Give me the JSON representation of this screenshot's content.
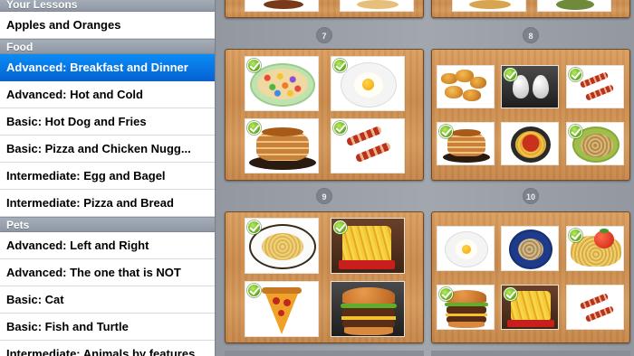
{
  "sidebar": {
    "sections": [
      {
        "title": "Your Lessons",
        "items": [
          "Apples and Oranges"
        ]
      },
      {
        "title": "Food",
        "items": [
          "Advanced: Breakfast and Dinner",
          "Advanced: Hot and Cold",
          "Basic: Hot Dog and Fries",
          "Basic: Pizza and Chicken Nugg...",
          "Intermediate: Egg and Bagel",
          "Intermediate: Pizza and Bread"
        ]
      },
      {
        "title": "Pets",
        "items": [
          "Advanced: Left and Right",
          "Advanced: The one that is NOT",
          "Basic: Cat",
          "Basic: Fish and Turtle",
          "Intermediate: Animals by features"
        ]
      }
    ],
    "selected_item": "Advanced: Breakfast and Dinner"
  },
  "cards": {
    "page_numbers": [
      "7",
      "8",
      "9",
      "10"
    ],
    "card7": {
      "tiles": [
        "cereal-bowl",
        "fried-egg",
        "pancakes",
        "bacon"
      ],
      "checked": [
        true,
        true,
        true,
        true
      ]
    },
    "card8": {
      "tiles": [
        "chicken-nuggets",
        "eggs",
        "bacon",
        "pancakes",
        "spaghetti-sauce",
        "noodles-bowl"
      ],
      "checked": [
        false,
        true,
        true,
        true,
        false,
        true
      ]
    },
    "card9": {
      "tiles": [
        "spaghetti-plate",
        "french-fries",
        "pizza-slice",
        "hamburger"
      ],
      "checked": [
        true,
        true,
        true,
        false
      ]
    },
    "card10": {
      "tiles": [
        "fried-egg",
        "noodles-bowl",
        "spaghetti-tomato",
        "hamburger",
        "french-fries",
        "bacon"
      ],
      "checked": [
        false,
        false,
        true,
        true,
        true,
        false
      ]
    }
  },
  "colors": {
    "selected_row": "#0563d3",
    "section_header": "#98a1ad",
    "wood_card": "#d09455",
    "check_badge": "#5fa81e"
  }
}
